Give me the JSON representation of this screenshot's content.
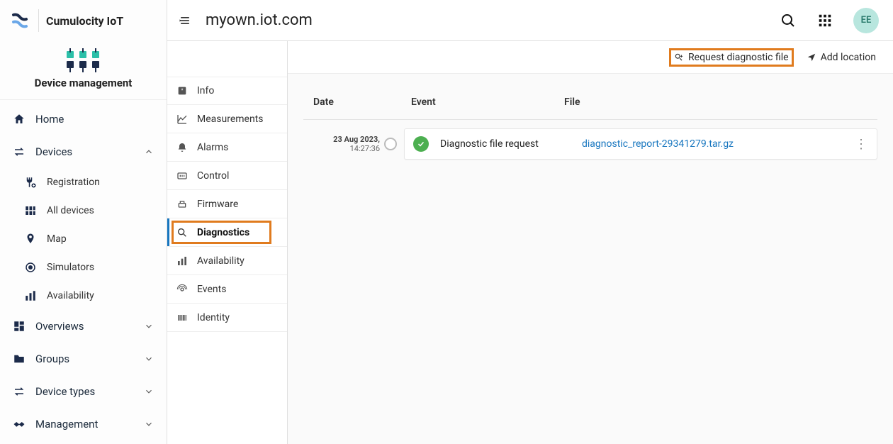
{
  "brand": {
    "product": "Cumulocity IoT",
    "module": "Device management"
  },
  "header": {
    "breadcrumb": "myown.iot.com",
    "avatar_initials": "EE"
  },
  "nav": {
    "home": "Home",
    "devices": {
      "label": "Devices",
      "items": [
        "Registration",
        "All devices",
        "Map",
        "Simulators",
        "Availability"
      ]
    },
    "overviews": "Overviews",
    "groups": "Groups",
    "device_types": "Device types",
    "management": "Management"
  },
  "tabs": [
    "Info",
    "Measurements",
    "Alarms",
    "Control",
    "Firmware",
    "Diagnostics",
    "Availability",
    "Events",
    "Identity"
  ],
  "tabs_active_index": 5,
  "actions": {
    "request_diagnostic": "Request diagnostic file",
    "add_location": "Add location"
  },
  "table": {
    "columns": {
      "date": "Date",
      "event": "Event",
      "file": "File"
    },
    "rows": [
      {
        "date": "23 Aug 2023,",
        "time": "14:27:36",
        "event": "Diagnostic file request",
        "file": "diagnostic_report-29341279.tar.gz",
        "status": "success"
      }
    ]
  }
}
